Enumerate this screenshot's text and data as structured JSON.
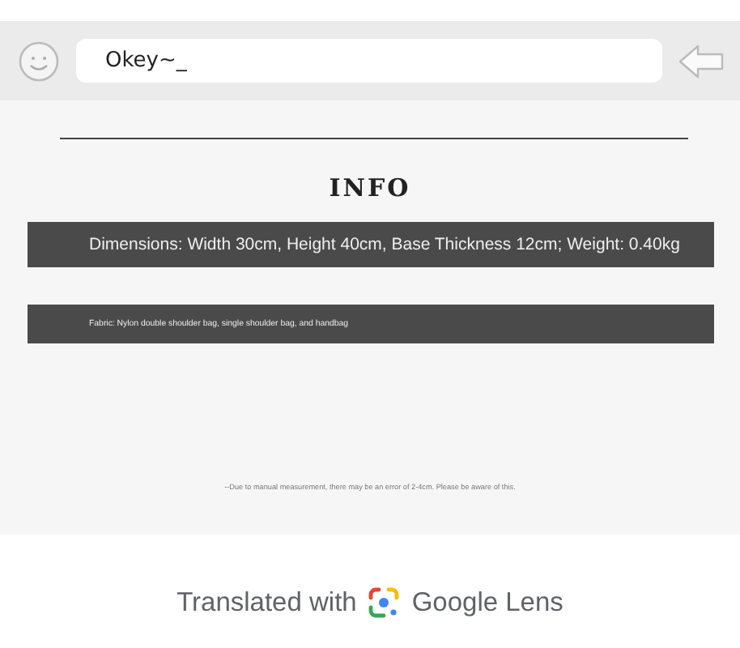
{
  "chat_bar": {
    "value": "Okey~_"
  },
  "info": {
    "heading": "INFO",
    "rows": [
      {
        "text": "Dimensions: Width 30cm, Height 40cm, Base Thickness 12cm; Weight: 0.40kg",
        "kind": "large"
      },
      {
        "text": "Fabric: Nylon double shoulder bag, single shoulder bag, and handbag",
        "kind": "small"
      }
    ],
    "note": "--Due to manual measurement, there may be an error of 2-4cm. Please be aware of this."
  },
  "footer": {
    "prefix": "Translated with",
    "brand": "Google Lens"
  }
}
